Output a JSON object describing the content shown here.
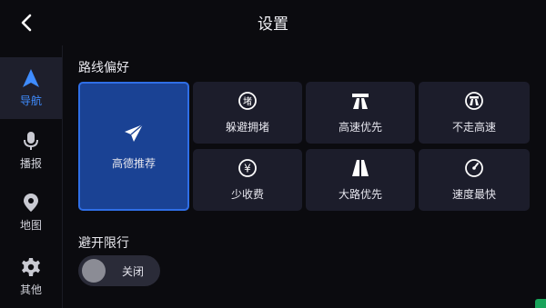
{
  "header": {
    "title": "设置"
  },
  "sidebar": {
    "items": [
      {
        "label": "导航",
        "icon": "navigation-arrow-icon",
        "active": true
      },
      {
        "label": "播报",
        "icon": "microphone-icon",
        "active": false
      },
      {
        "label": "地图",
        "icon": "map-pin-icon",
        "active": false
      },
      {
        "label": "其他",
        "icon": "gear-icon",
        "active": false
      }
    ]
  },
  "route_pref": {
    "title": "路线偏好",
    "options": [
      {
        "label": "高德推荐",
        "icon": "paper-plane-icon",
        "selected": true
      },
      {
        "label": "躲避拥堵",
        "icon": "avoid-congestion-icon",
        "selected": false
      },
      {
        "label": "高速优先",
        "icon": "highway-icon",
        "selected": false
      },
      {
        "label": "不走高速",
        "icon": "no-highway-icon",
        "selected": false
      },
      {
        "label": "少收费",
        "icon": "yuan-coin-icon",
        "selected": false
      },
      {
        "label": "大路优先",
        "icon": "main-road-icon",
        "selected": false
      },
      {
        "label": "速度最快",
        "icon": "speedometer-icon",
        "selected": false
      }
    ]
  },
  "restriction": {
    "title": "避开限行",
    "toggle_label": "关闭",
    "enabled": false
  },
  "colors": {
    "accent": "#3f8cff",
    "selected_card": "#1a4294",
    "card": "#1c1d2b",
    "background": "#0b0b0f"
  }
}
